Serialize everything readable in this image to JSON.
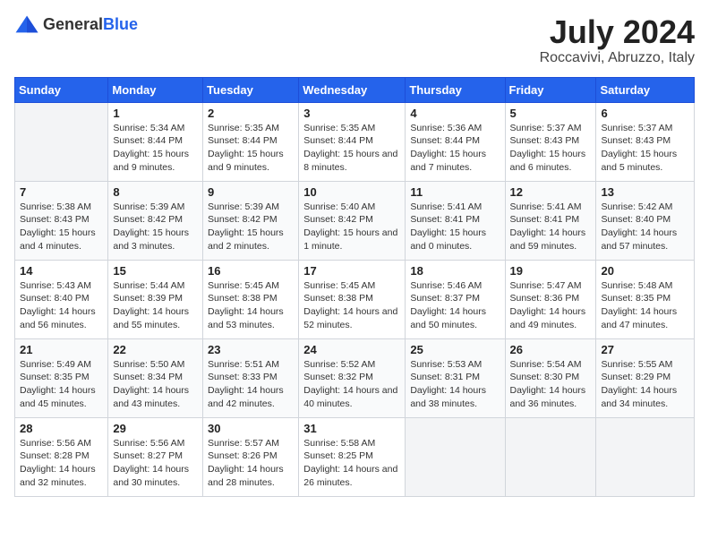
{
  "header": {
    "logo_general": "General",
    "logo_blue": "Blue",
    "month_year": "July 2024",
    "location": "Roccavivi, Abruzzo, Italy"
  },
  "calendar": {
    "days_of_week": [
      "Sunday",
      "Monday",
      "Tuesday",
      "Wednesday",
      "Thursday",
      "Friday",
      "Saturday"
    ],
    "weeks": [
      [
        {
          "day": "",
          "empty": true
        },
        {
          "day": "1",
          "sunrise": "Sunrise: 5:34 AM",
          "sunset": "Sunset: 8:44 PM",
          "daylight": "Daylight: 15 hours and 9 minutes."
        },
        {
          "day": "2",
          "sunrise": "Sunrise: 5:35 AM",
          "sunset": "Sunset: 8:44 PM",
          "daylight": "Daylight: 15 hours and 9 minutes."
        },
        {
          "day": "3",
          "sunrise": "Sunrise: 5:35 AM",
          "sunset": "Sunset: 8:44 PM",
          "daylight": "Daylight: 15 hours and 8 minutes."
        },
        {
          "day": "4",
          "sunrise": "Sunrise: 5:36 AM",
          "sunset": "Sunset: 8:44 PM",
          "daylight": "Daylight: 15 hours and 7 minutes."
        },
        {
          "day": "5",
          "sunrise": "Sunrise: 5:37 AM",
          "sunset": "Sunset: 8:43 PM",
          "daylight": "Daylight: 15 hours and 6 minutes."
        },
        {
          "day": "6",
          "sunrise": "Sunrise: 5:37 AM",
          "sunset": "Sunset: 8:43 PM",
          "daylight": "Daylight: 15 hours and 5 minutes."
        }
      ],
      [
        {
          "day": "7",
          "sunrise": "Sunrise: 5:38 AM",
          "sunset": "Sunset: 8:43 PM",
          "daylight": "Daylight: 15 hours and 4 minutes."
        },
        {
          "day": "8",
          "sunrise": "Sunrise: 5:39 AM",
          "sunset": "Sunset: 8:42 PM",
          "daylight": "Daylight: 15 hours and 3 minutes."
        },
        {
          "day": "9",
          "sunrise": "Sunrise: 5:39 AM",
          "sunset": "Sunset: 8:42 PM",
          "daylight": "Daylight: 15 hours and 2 minutes."
        },
        {
          "day": "10",
          "sunrise": "Sunrise: 5:40 AM",
          "sunset": "Sunset: 8:42 PM",
          "daylight": "Daylight: 15 hours and 1 minute."
        },
        {
          "day": "11",
          "sunrise": "Sunrise: 5:41 AM",
          "sunset": "Sunset: 8:41 PM",
          "daylight": "Daylight: 15 hours and 0 minutes."
        },
        {
          "day": "12",
          "sunrise": "Sunrise: 5:41 AM",
          "sunset": "Sunset: 8:41 PM",
          "daylight": "Daylight: 14 hours and 59 minutes."
        },
        {
          "day": "13",
          "sunrise": "Sunrise: 5:42 AM",
          "sunset": "Sunset: 8:40 PM",
          "daylight": "Daylight: 14 hours and 57 minutes."
        }
      ],
      [
        {
          "day": "14",
          "sunrise": "Sunrise: 5:43 AM",
          "sunset": "Sunset: 8:40 PM",
          "daylight": "Daylight: 14 hours and 56 minutes."
        },
        {
          "day": "15",
          "sunrise": "Sunrise: 5:44 AM",
          "sunset": "Sunset: 8:39 PM",
          "daylight": "Daylight: 14 hours and 55 minutes."
        },
        {
          "day": "16",
          "sunrise": "Sunrise: 5:45 AM",
          "sunset": "Sunset: 8:38 PM",
          "daylight": "Daylight: 14 hours and 53 minutes."
        },
        {
          "day": "17",
          "sunrise": "Sunrise: 5:45 AM",
          "sunset": "Sunset: 8:38 PM",
          "daylight": "Daylight: 14 hours and 52 minutes."
        },
        {
          "day": "18",
          "sunrise": "Sunrise: 5:46 AM",
          "sunset": "Sunset: 8:37 PM",
          "daylight": "Daylight: 14 hours and 50 minutes."
        },
        {
          "day": "19",
          "sunrise": "Sunrise: 5:47 AM",
          "sunset": "Sunset: 8:36 PM",
          "daylight": "Daylight: 14 hours and 49 minutes."
        },
        {
          "day": "20",
          "sunrise": "Sunrise: 5:48 AM",
          "sunset": "Sunset: 8:35 PM",
          "daylight": "Daylight: 14 hours and 47 minutes."
        }
      ],
      [
        {
          "day": "21",
          "sunrise": "Sunrise: 5:49 AM",
          "sunset": "Sunset: 8:35 PM",
          "daylight": "Daylight: 14 hours and 45 minutes."
        },
        {
          "day": "22",
          "sunrise": "Sunrise: 5:50 AM",
          "sunset": "Sunset: 8:34 PM",
          "daylight": "Daylight: 14 hours and 43 minutes."
        },
        {
          "day": "23",
          "sunrise": "Sunrise: 5:51 AM",
          "sunset": "Sunset: 8:33 PM",
          "daylight": "Daylight: 14 hours and 42 minutes."
        },
        {
          "day": "24",
          "sunrise": "Sunrise: 5:52 AM",
          "sunset": "Sunset: 8:32 PM",
          "daylight": "Daylight: 14 hours and 40 minutes."
        },
        {
          "day": "25",
          "sunrise": "Sunrise: 5:53 AM",
          "sunset": "Sunset: 8:31 PM",
          "daylight": "Daylight: 14 hours and 38 minutes."
        },
        {
          "day": "26",
          "sunrise": "Sunrise: 5:54 AM",
          "sunset": "Sunset: 8:30 PM",
          "daylight": "Daylight: 14 hours and 36 minutes."
        },
        {
          "day": "27",
          "sunrise": "Sunrise: 5:55 AM",
          "sunset": "Sunset: 8:29 PM",
          "daylight": "Daylight: 14 hours and 34 minutes."
        }
      ],
      [
        {
          "day": "28",
          "sunrise": "Sunrise: 5:56 AM",
          "sunset": "Sunset: 8:28 PM",
          "daylight": "Daylight: 14 hours and 32 minutes."
        },
        {
          "day": "29",
          "sunrise": "Sunrise: 5:56 AM",
          "sunset": "Sunset: 8:27 PM",
          "daylight": "Daylight: 14 hours and 30 minutes."
        },
        {
          "day": "30",
          "sunrise": "Sunrise: 5:57 AM",
          "sunset": "Sunset: 8:26 PM",
          "daylight": "Daylight: 14 hours and 28 minutes."
        },
        {
          "day": "31",
          "sunrise": "Sunrise: 5:58 AM",
          "sunset": "Sunset: 8:25 PM",
          "daylight": "Daylight: 14 hours and 26 minutes."
        },
        {
          "day": "",
          "empty": true
        },
        {
          "day": "",
          "empty": true
        },
        {
          "day": "",
          "empty": true
        }
      ]
    ]
  }
}
